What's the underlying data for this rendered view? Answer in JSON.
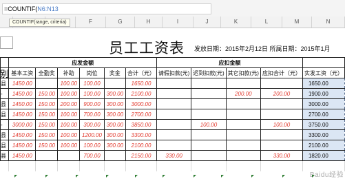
{
  "formula": {
    "prefix": "=COUNTIF(",
    "ref": "N6:N13"
  },
  "tooltip": {
    "text": "COUNTIF(range, criteria)"
  },
  "columns": [
    "F",
    "G",
    "H",
    "I",
    "J",
    "K",
    "L",
    "M",
    "N"
  ],
  "sheet": {
    "title": "员工工资表",
    "date_info": "发放日期：2015年2月12日  所属日期：2015年1月",
    "left_label": "别",
    "group_headers": {
      "pay": "应发金额",
      "deduct": "应扣金额"
    },
    "headers": {
      "base": "基本工资",
      "attendance": "全勤奖",
      "subsidy": "补助",
      "position": "岗位",
      "bonus": "奖金",
      "total": "合计（元）",
      "leave": "请假扣款(元)",
      "late": "迟到扣款(元)",
      "other": "其它扣款(元)",
      "deduct_total": "应扣合计（元）",
      "net": "实发工资（元）"
    },
    "rows": [
      {
        "stub": "县",
        "base": "1450.00",
        "attendance": "",
        "subsidy": "100.00",
        "position": "100.00",
        "bonus": "",
        "total": "1650.00",
        "leave": "",
        "late": "",
        "other": "",
        "deduct_total": "",
        "net": "1650.00"
      },
      {
        "stub": "-",
        "base": "1450.00",
        "attendance": "150.00",
        "subsidy": "100.00",
        "position": "100.00",
        "bonus": "300.00",
        "total": "2100.00",
        "leave": "",
        "late": "",
        "other": "200.00",
        "deduct_total": "200.00",
        "net": "1900.00"
      },
      {
        "stub": "县",
        "base": "1450.00",
        "attendance": "150.00",
        "subsidy": "200.00",
        "position": "900.00",
        "bonus": "300.00",
        "total": "3000.00",
        "leave": "",
        "late": "",
        "other": "",
        "deduct_total": "",
        "net": "3000.00"
      },
      {
        "stub": "县",
        "base": "1450.00",
        "attendance": "150.00",
        "subsidy": "100.00",
        "position": "700.00",
        "bonus": "300.00",
        "total": "2700.00",
        "leave": "",
        "late": "",
        "other": "",
        "deduct_total": "",
        "net": "2700.00"
      },
      {
        "stub": "-",
        "base": "3000.00",
        "attendance": "150.00",
        "subsidy": "100.00",
        "position": "300.00",
        "bonus": "300.00",
        "total": "3850.00",
        "leave": "",
        "late": "100.00",
        "other": "",
        "deduct_total": "100.00",
        "net": "3750.00"
      },
      {
        "stub": "县",
        "base": "1450.00",
        "attendance": "150.00",
        "subsidy": "100.00",
        "position": "1200.00",
        "bonus": "300.00",
        "total": "3300.00",
        "leave": "",
        "late": "",
        "other": "",
        "deduct_total": "",
        "net": "3300.00"
      },
      {
        "stub": "县",
        "base": "1450.00",
        "attendance": "150.00",
        "subsidy": "100.00",
        "position": "100.00",
        "bonus": "300.00",
        "total": "2100.00",
        "leave": "",
        "late": "",
        "other": "",
        "deduct_total": "",
        "net": "2100.00"
      },
      {
        "stub": "县",
        "base": "1450.00",
        "attendance": "",
        "subsidy": "",
        "position": "700.00",
        "bonus": "",
        "total": "2150.00",
        "leave": "330.00",
        "late": "",
        "other": "",
        "deduct_total": "330.00",
        "net": "1820.00"
      }
    ]
  },
  "watermark": "Baidu经验"
}
